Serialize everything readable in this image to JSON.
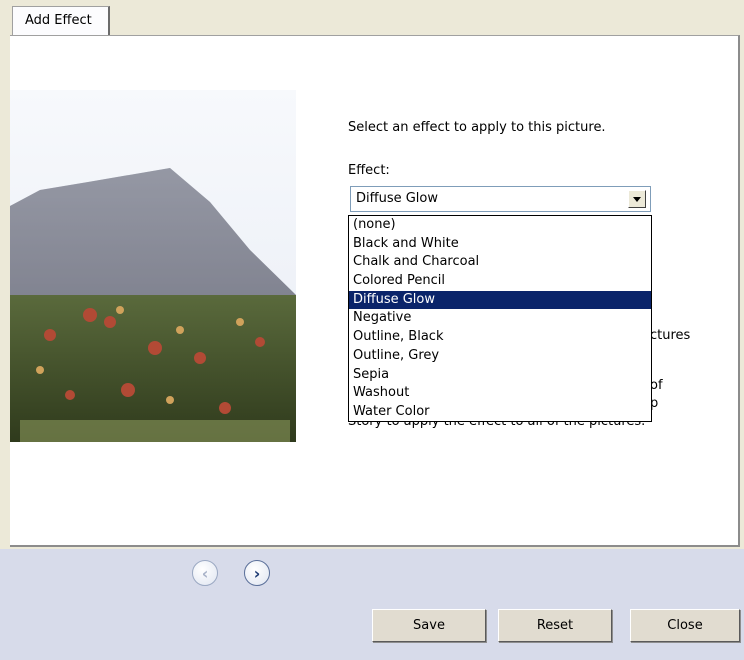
{
  "tab": {
    "label": "Add Effect"
  },
  "panel": {
    "instruction": "Select an effect to apply to this picture.",
    "effect_label": "Effect:",
    "selected_effect": "Diffuse Glow",
    "hidden_text_1": "ctures",
    "hidden_text_2": "of",
    "hidden_text_3": "p",
    "hidden_text_4": "Story to apply the effect to all of the pictures."
  },
  "effect_options": [
    "(none)",
    "Black and White",
    "Chalk and Charcoal",
    "Colored Pencil",
    "Diffuse Glow",
    "Negative",
    "Outline, Black",
    "Outline, Grey",
    "Sepia",
    "Washout",
    "Water Color"
  ],
  "selected_index": 4,
  "nav": {
    "prev_icon": "chevron-left-icon",
    "next_icon": "chevron-right-icon"
  },
  "buttons": {
    "save": "Save",
    "reset": "Reset",
    "close": "Close"
  },
  "colors": {
    "selection": "#0a246a",
    "footer": "#d7dbea",
    "background": "#ece9d8"
  }
}
